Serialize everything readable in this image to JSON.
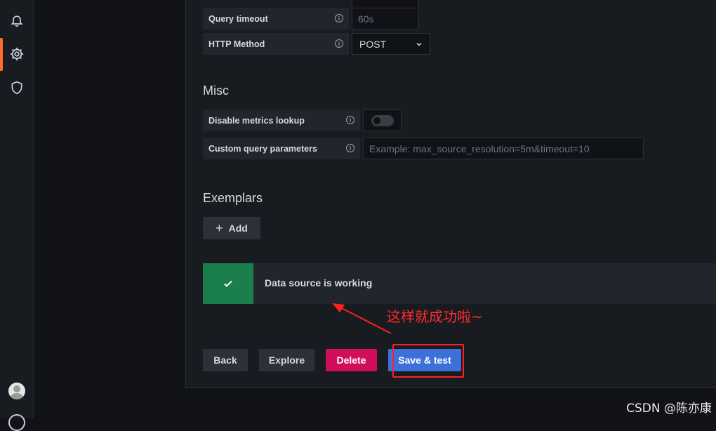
{
  "http": {
    "query_timeout": {
      "label": "Query timeout",
      "placeholder": "60s"
    },
    "http_method": {
      "label": "HTTP Method",
      "value": "POST"
    }
  },
  "misc": {
    "title": "Misc",
    "disable_metrics_lookup": {
      "label": "Disable metrics lookup",
      "enabled": false
    },
    "custom_query_params": {
      "label": "Custom query parameters",
      "placeholder": "Example: max_source_resolution=5m&timeout=10"
    }
  },
  "exemplars": {
    "title": "Exemplars",
    "add_label": "Add"
  },
  "alert": {
    "message": "Data source is working",
    "status_color": "#1a7f4b"
  },
  "actions": {
    "back": "Back",
    "explore": "Explore",
    "delete": "Delete",
    "save_test": "Save & test"
  },
  "annotation": {
    "text": "这样就成功啦~",
    "color": "#ff2d2d"
  },
  "watermark": "CSDN @陈亦康",
  "sidebar": {
    "icons": [
      "bell-icon",
      "gear-icon",
      "shield-icon"
    ],
    "accent": "#ff6a2c"
  }
}
